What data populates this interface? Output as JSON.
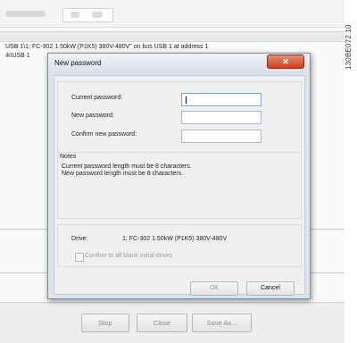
{
  "side_code": "130BE072.10",
  "background": {
    "address_line": "USB 1\\1; FC-302 1.50kW (P1K5) 380V-480V\" on bus USB 1 at address 1",
    "address_line_partial": "ık\\USB 1",
    "buttons": {
      "stop": "Stop",
      "close": "Close",
      "save_as": "Save As..."
    }
  },
  "dialog": {
    "title": "New password",
    "close_glyph": "✕",
    "fields": {
      "current_label": "Current password:",
      "new_label": "New password:",
      "confirm_label": "Confirm new password:"
    },
    "notes": {
      "heading": "Notes",
      "lines": [
        "Current password length must be 8 characters.",
        "New password length must be 8 characters."
      ]
    },
    "drive": {
      "label": "Drive:",
      "value": "1; FC-302 1.50kW (P1K5) 380V-480V",
      "checkbox_label": "Confirm to all blank initial drives"
    },
    "buttons": {
      "ok": "OK",
      "cancel": "Cancel"
    }
  }
}
